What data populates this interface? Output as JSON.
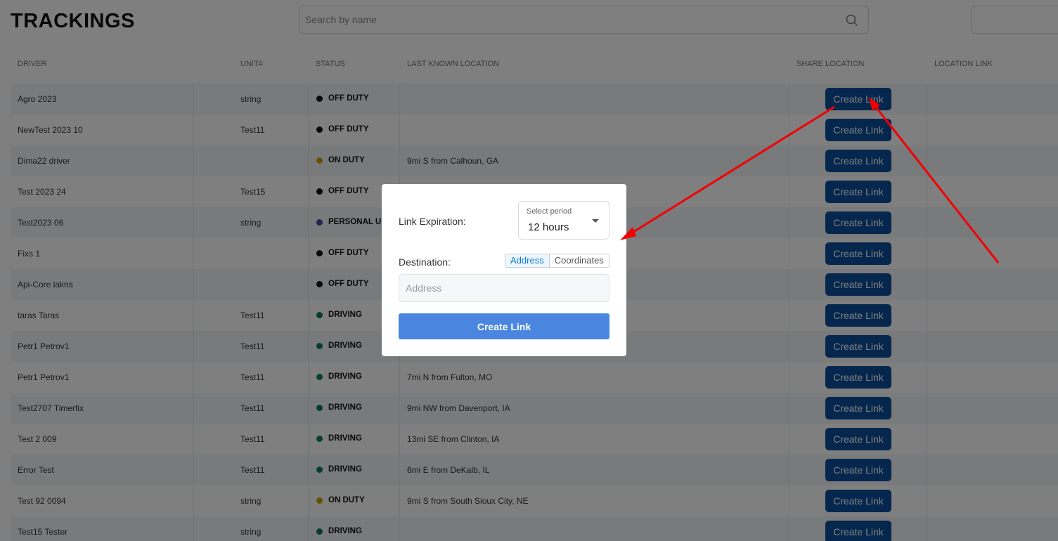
{
  "page": {
    "title": "TRACKINGS"
  },
  "search": {
    "placeholder": "Search by name"
  },
  "table": {
    "headers": {
      "driver": "DRIVER",
      "unit": "UNIT#",
      "status": "STATUS",
      "last_location": "LAST KNOWN LOCATION",
      "share_location": "SHARE LOCATION",
      "location_link": "LOCATION LINK"
    },
    "create_link_label": "Create Link",
    "rows": [
      {
        "driver": "Agro 2023",
        "unit": "string",
        "status": "OFF DUTY",
        "status_color": "#111111",
        "location": ""
      },
      {
        "driver": "NewTest 2023 10",
        "unit": "Test11",
        "status": "OFF DUTY",
        "status_color": "#111111",
        "location": ""
      },
      {
        "driver": "Dima22 driver",
        "unit": "",
        "status": "ON DUTY",
        "status_color": "#c9a400",
        "location": "9mi S from Calhoun, GA"
      },
      {
        "driver": "Test 2023 24",
        "unit": "Test15",
        "status": "OFF DUTY",
        "status_color": "#111111",
        "location": ""
      },
      {
        "driver": "Test2023 06",
        "unit": "string",
        "status": "PERSONAL USE",
        "status_color": "#5b3fa8",
        "location": ""
      },
      {
        "driver": "Fixs 1",
        "unit": "",
        "status": "OFF DUTY",
        "status_color": "#111111",
        "location": ""
      },
      {
        "driver": "Api-Core lakns",
        "unit": "",
        "status": "OFF DUTY",
        "status_color": "#111111",
        "location": ""
      },
      {
        "driver": "taras Taras",
        "unit": "Test11",
        "status": "DRIVING",
        "status_color": "#0f7a55",
        "location": ""
      },
      {
        "driver": "Petr1 Petrov1",
        "unit": "Test11",
        "status": "DRIVING",
        "status_color": "#0f7a55",
        "location": ""
      },
      {
        "driver": "Petr1 Petrov1",
        "unit": "Test11",
        "status": "DRIVING",
        "status_color": "#0f7a55",
        "location": "7mi N from Fulton, MO"
      },
      {
        "driver": "Test2707 Timerfix",
        "unit": "Test11",
        "status": "DRIVING",
        "status_color": "#0f7a55",
        "location": "9mi NW from Davenport, IA"
      },
      {
        "driver": "Test 2 009",
        "unit": "Test11",
        "status": "DRIVING",
        "status_color": "#0f7a55",
        "location": "13mi SE from Clinton, IA"
      },
      {
        "driver": "Error Test",
        "unit": "Test11",
        "status": "DRIVING",
        "status_color": "#0f7a55",
        "location": "6mi E from DeKalb, IL"
      },
      {
        "driver": "Test 92 0094",
        "unit": "string",
        "status": "ON DUTY",
        "status_color": "#c9a400",
        "location": "9mi S from South Sioux City, NE"
      },
      {
        "driver": "Test15 Tester",
        "unit": "string",
        "status": "DRIVING",
        "status_color": "#0f7a55",
        "location": ""
      }
    ]
  },
  "modal": {
    "expiration_label": "Link Expiration:",
    "period_caption": "Select period",
    "period_value": "12 hours",
    "destination_label": "Destination:",
    "toggle_address": "Address",
    "toggle_coordinates": "Coordinates",
    "address_placeholder": "Address",
    "create_button": "Create Link"
  },
  "colors": {
    "primary_button": "#0a4f9c",
    "modal_button": "#4a86e0",
    "annotation_arrow": "#ff0000"
  }
}
